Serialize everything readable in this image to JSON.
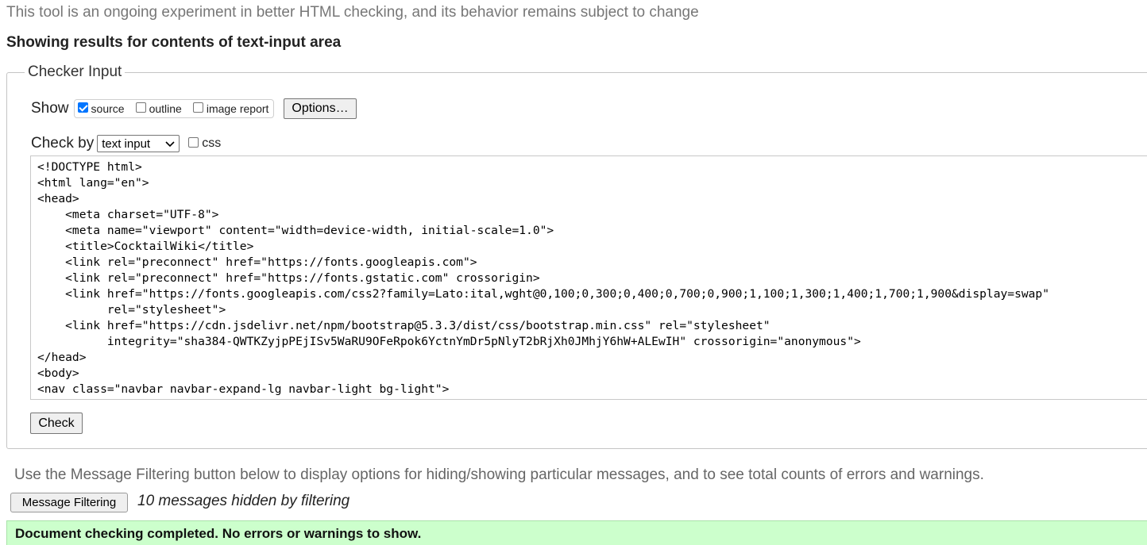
{
  "header": {
    "experiment_note": "This tool is an ongoing experiment in better HTML checking, and its behavior remains subject to change",
    "results_heading": "Showing results for contents of text-input area"
  },
  "checker_input": {
    "legend": "Checker Input",
    "show_label": "Show",
    "show_options": [
      {
        "label": "source",
        "checked": true
      },
      {
        "label": "outline",
        "checked": false
      },
      {
        "label": "image report",
        "checked": false
      }
    ],
    "options_button": "Options…",
    "check_by_label": "Check by",
    "check_by_selected": "text input",
    "css_option": {
      "label": "css",
      "checked": false
    },
    "source_lines": [
      "<!DOCTYPE html>",
      "<html lang=\"en\">",
      "<head>",
      "    <meta charset=\"UTF-8\">",
      "    <meta name=\"viewport\" content=\"width=device-width, initial-scale=1.0\">",
      "    <title>CocktailWiki</title>",
      "    <link rel=\"preconnect\" href=\"https://fonts.googleapis.com\">",
      "    <link rel=\"preconnect\" href=\"https://fonts.gstatic.com\" crossorigin>",
      "    <link href=\"https://fonts.googleapis.com/css2?family=Lato:ital,wght@0,100;0,300;0,400;0,700;0,900;1,100;1,300;1,400;1,700;1,900&display=swap\"",
      "          rel=\"stylesheet\">",
      "    <link href=\"https://cdn.jsdelivr.net/npm/bootstrap@5.3.3/dist/css/bootstrap.min.css\" rel=\"stylesheet\"",
      "          integrity=\"sha384-QWTKZyjpPEjISv5WaRU9OFeRpok6YctnYmDr5pNlyT2bRjXh0JMhjY6hW+ALEwIH\" crossorigin=\"anonymous\">",
      "</head>",
      "<body>",
      "<nav class=\"navbar navbar-expand-lg navbar-light bg-light\">"
    ],
    "check_button": "Check"
  },
  "filtering": {
    "note": "Use the Message Filtering button below to display options for hiding/showing particular messages, and to see total counts of errors and warnings.",
    "button": "Message Filtering",
    "hidden_count": "10 messages hidden by filtering"
  },
  "status": {
    "message": "Document checking completed. No errors or warnings to show.",
    "color": "#ccffcc"
  }
}
